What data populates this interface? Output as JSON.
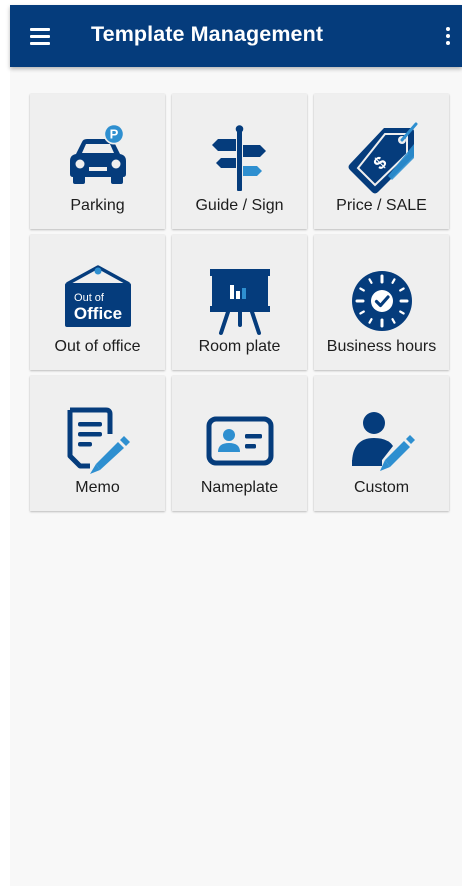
{
  "appbar": {
    "title": "Template Management",
    "background": "#053c7c",
    "menu_icon": "hamburger-menu-icon",
    "overflow_icon": "more-vertical-icon"
  },
  "accent_color": "#053c7c",
  "templates": [
    {
      "label": "Parking",
      "icon": "parking-car-icon",
      "badge": "P"
    },
    {
      "label": "Guide / Sign",
      "icon": "signpost-icon"
    },
    {
      "label": "Price / SALE",
      "icon": "price-tag-icon",
      "symbol": "$"
    },
    {
      "label": "Out of office",
      "icon": "out-of-office-sign-icon",
      "sign_line1": "Out of",
      "sign_line2": "Office"
    },
    {
      "label": "Room plate",
      "icon": "presentation-board-icon"
    },
    {
      "label": "Business hours",
      "icon": "clock-icon"
    },
    {
      "label": "Memo",
      "icon": "memo-pencil-icon"
    },
    {
      "label": "Nameplate",
      "icon": "id-card-icon"
    },
    {
      "label": "Custom",
      "icon": "user-edit-icon"
    }
  ]
}
